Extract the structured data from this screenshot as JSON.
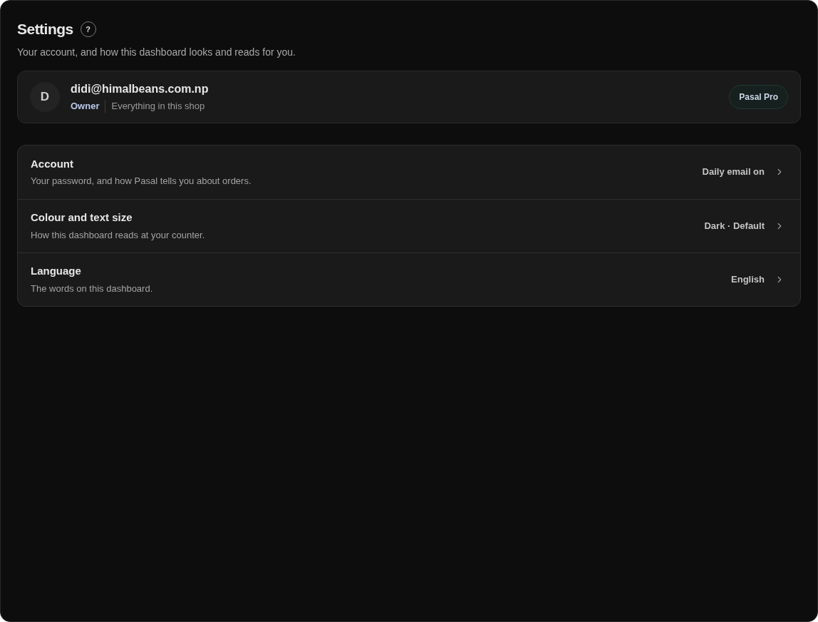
{
  "header": {
    "title": "Settings",
    "help": "?",
    "subtitle": "Your account, and how this dashboard looks and reads for you."
  },
  "profile": {
    "initial": "D",
    "email": "didi@himalbeans.com.np",
    "role": "Owner",
    "scope": "Everything in this shop",
    "plan": "Pasal Pro"
  },
  "settings": [
    {
      "title": "Account",
      "description": "Your password, and how Pasal tells you about orders.",
      "value": "Daily email on"
    },
    {
      "title": "Colour and text size",
      "description": "How this dashboard reads at your counter.",
      "value": "Dark · Default"
    },
    {
      "title": "Language",
      "description": "The words on this dashboard.",
      "value": "English"
    }
  ]
}
